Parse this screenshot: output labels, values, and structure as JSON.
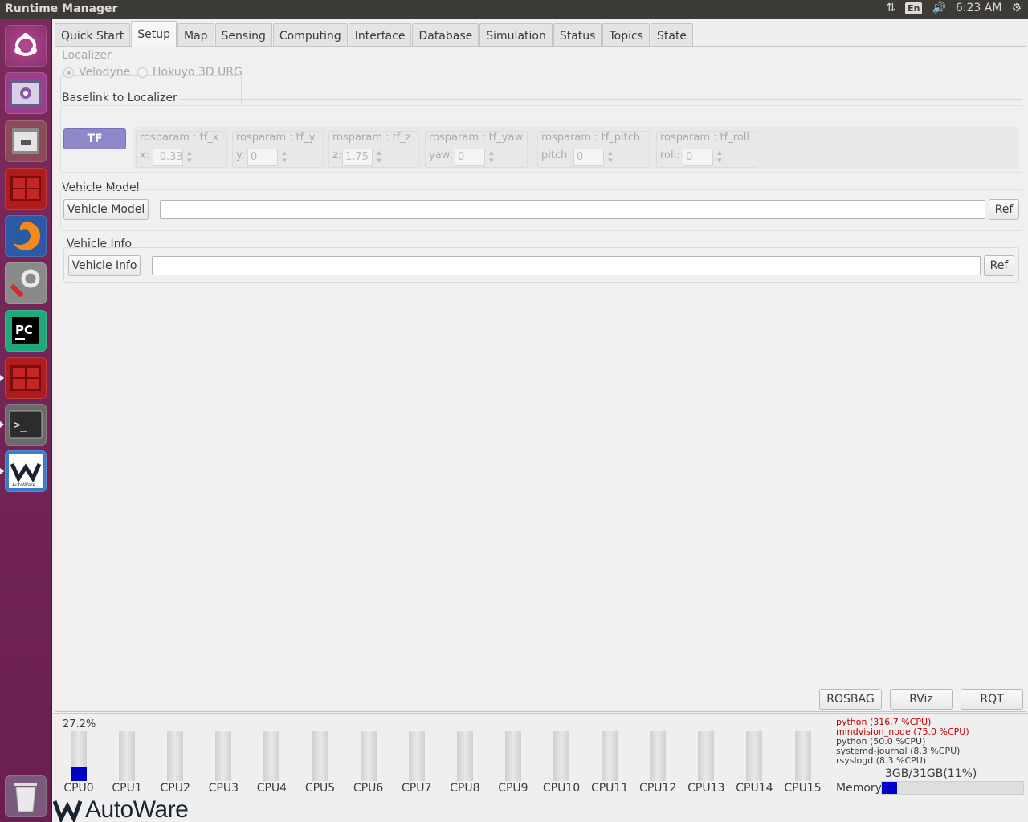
{
  "window": {
    "title": "Runtime Manager"
  },
  "tray": {
    "lang": "En",
    "time": "6:23 AM"
  },
  "tabs": [
    "Quick Start",
    "Setup",
    "Map",
    "Sensing",
    "Computing",
    "Interface",
    "Database",
    "Simulation",
    "Status",
    "Topics",
    "State"
  ],
  "active_tab": "Setup",
  "localizer": {
    "label": "Localizer",
    "options": [
      "Velodyne",
      "Hokuyo 3D URG"
    ]
  },
  "baselink": {
    "label": "Baselink to Localizer",
    "tf_button": "TF",
    "params": [
      {
        "label": "rosparam : tf_x",
        "axis": "x:",
        "value": "-0.33"
      },
      {
        "label": "rosparam : tf_y",
        "axis": "y:",
        "value": "0"
      },
      {
        "label": "rosparam : tf_z",
        "axis": "z:",
        "value": "1.75"
      },
      {
        "label": "rosparam : tf_yaw",
        "axis": "yaw:",
        "value": "0"
      },
      {
        "label": "rosparam : tf_pitch",
        "axis": "pitch:",
        "value": "0"
      },
      {
        "label": "rosparam : tf_roll",
        "axis": "roll:",
        "value": "0"
      }
    ]
  },
  "vehicle_model": {
    "label": "Vehicle Model",
    "button": "Vehicle Model",
    "ref": "Ref"
  },
  "vehicle_info": {
    "label": "Vehicle Info",
    "button": "Vehicle Info",
    "ref": "Ref"
  },
  "tools": {
    "rosbag": "ROSBAG",
    "rviz": "RViz",
    "rqt": "RQT"
  },
  "cpu": {
    "usage_label": "27.2%",
    "cores": [
      {
        "name": "CPU0",
        "usage": 0.27
      },
      {
        "name": "CPU1",
        "usage": 0
      },
      {
        "name": "CPU2",
        "usage": 0
      },
      {
        "name": "CPU3",
        "usage": 0
      },
      {
        "name": "CPU4",
        "usage": 0
      },
      {
        "name": "CPU5",
        "usage": 0
      },
      {
        "name": "CPU6",
        "usage": 0
      },
      {
        "name": "CPU7",
        "usage": 0
      },
      {
        "name": "CPU8",
        "usage": 0
      },
      {
        "name": "CPU9",
        "usage": 0
      },
      {
        "name": "CPU10",
        "usage": 0
      },
      {
        "name": "CPU11",
        "usage": 0
      },
      {
        "name": "CPU12",
        "usage": 0
      },
      {
        "name": "CPU13",
        "usage": 0
      },
      {
        "name": "CPU14",
        "usage": 0
      },
      {
        "name": "CPU15",
        "usage": 0
      }
    ]
  },
  "processes": [
    {
      "text": "python (316.7 %CPU)",
      "color": "#c00000"
    },
    {
      "text": "mindvision_node (75.0 %CPU)",
      "color": "#c00000"
    },
    {
      "text": "python (50.0 %CPU)",
      "color": "#3c3c3c"
    },
    {
      "text": "systemd-journal (8.3 %CPU)",
      "color": "#3c3c3c"
    },
    {
      "text": "rsyslogd (8.3 %CPU)",
      "color": "#3c3c3c"
    }
  ],
  "memory": {
    "label": "Memory",
    "text": "3GB/31GB(11%)",
    "fraction": 0.11
  },
  "logo": {
    "text": "AutoWare"
  },
  "launcher": [
    "ubuntu-dash-icon",
    "video-editor-icon",
    "files-icon",
    "terminal-app-icon",
    "firefox-icon",
    "system-tools-icon",
    "pycharm-icon",
    "terminal-app-2-icon",
    "terminal-icon",
    "autoware-icon",
    "trash-icon"
  ]
}
